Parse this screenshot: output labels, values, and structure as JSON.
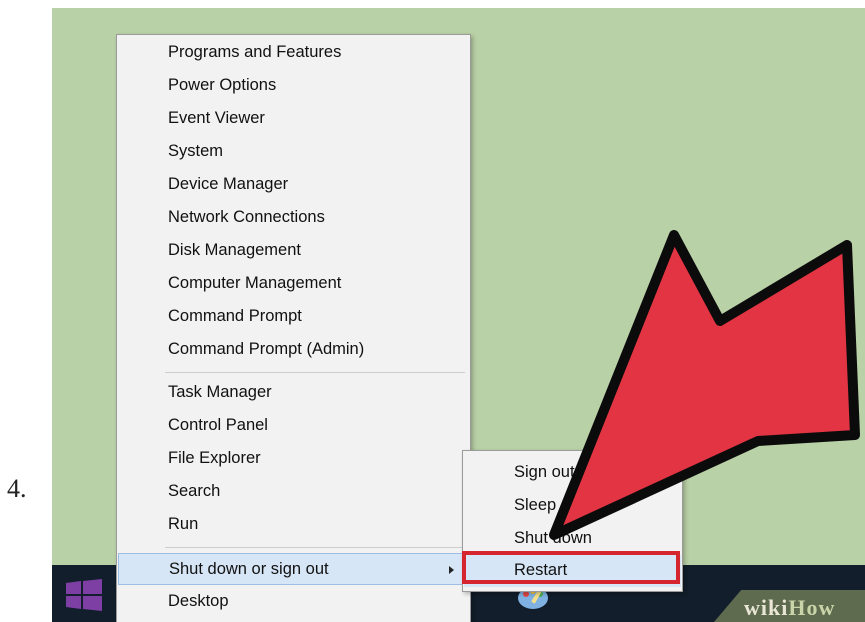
{
  "step_number": "4.",
  "context_menu": {
    "items": [
      {
        "label": "Programs and Features"
      },
      {
        "label": "Power Options"
      },
      {
        "label": "Event Viewer"
      },
      {
        "label": "System"
      },
      {
        "label": "Device Manager"
      },
      {
        "label": "Network Connections"
      },
      {
        "label": "Disk Management"
      },
      {
        "label": "Computer Management"
      },
      {
        "label": "Command Prompt"
      },
      {
        "label": "Command Prompt (Admin)"
      },
      {
        "label": "Task Manager"
      },
      {
        "label": "Control Panel"
      },
      {
        "label": "File Explorer"
      },
      {
        "label": "Search"
      },
      {
        "label": "Run"
      },
      {
        "label": "Shut down or sign out",
        "selected": true,
        "has_submenu": true
      },
      {
        "label": "Desktop"
      }
    ]
  },
  "submenu": {
    "items": [
      {
        "label": "Sign out"
      },
      {
        "label": "Sleep"
      },
      {
        "label": "Shut down"
      },
      {
        "label": "Restart",
        "selected": true,
        "highlighted": true
      }
    ]
  },
  "watermark": {
    "part1": "wiki",
    "part2": "How"
  },
  "colors": {
    "desktop": "#b9d1a6",
    "taskbar": "#121e2b",
    "arrow": "#e23443",
    "highlight_box": "#d5262f",
    "selection": "#d7e6f6",
    "start_logo": "#7e3fa5"
  },
  "icons": {
    "start_button": "windows-logo-icon",
    "submenu_indicator": "chevron-right-icon",
    "taskbar_app": "paint-icon",
    "pointer": "red-arrow-icon"
  }
}
